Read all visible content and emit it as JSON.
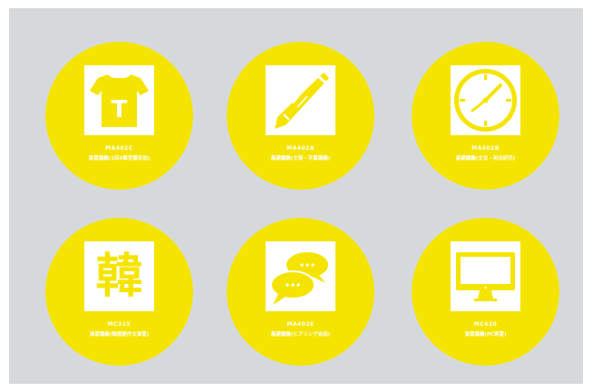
{
  "accent_color": "#f5e400",
  "background_color": "#d6d9dc",
  "courses": [
    {
      "code": "MA402C",
      "title": "演習講義(1回4章受講有効)",
      "icon": "tshirt-icon",
      "icon_letter": "T"
    },
    {
      "code": "MA402A",
      "title": "基礎講義(文部・字幕講義)",
      "icon": "pencil-icon"
    },
    {
      "code": "MA402B",
      "title": "基礎講義(文法・用法研究)",
      "icon": "clock-icon"
    },
    {
      "code": "MC315",
      "title": "演習講義(韓国語作文演習)",
      "icon": "kanji-icon",
      "icon_letter": "韓"
    },
    {
      "code": "MA402E",
      "title": "基礎講義(ヒアリング会話)",
      "icon": "speech-bubbles-icon"
    },
    {
      "code": "MC420",
      "title": "演習講義(PC実習)",
      "icon": "monitor-icon"
    }
  ]
}
